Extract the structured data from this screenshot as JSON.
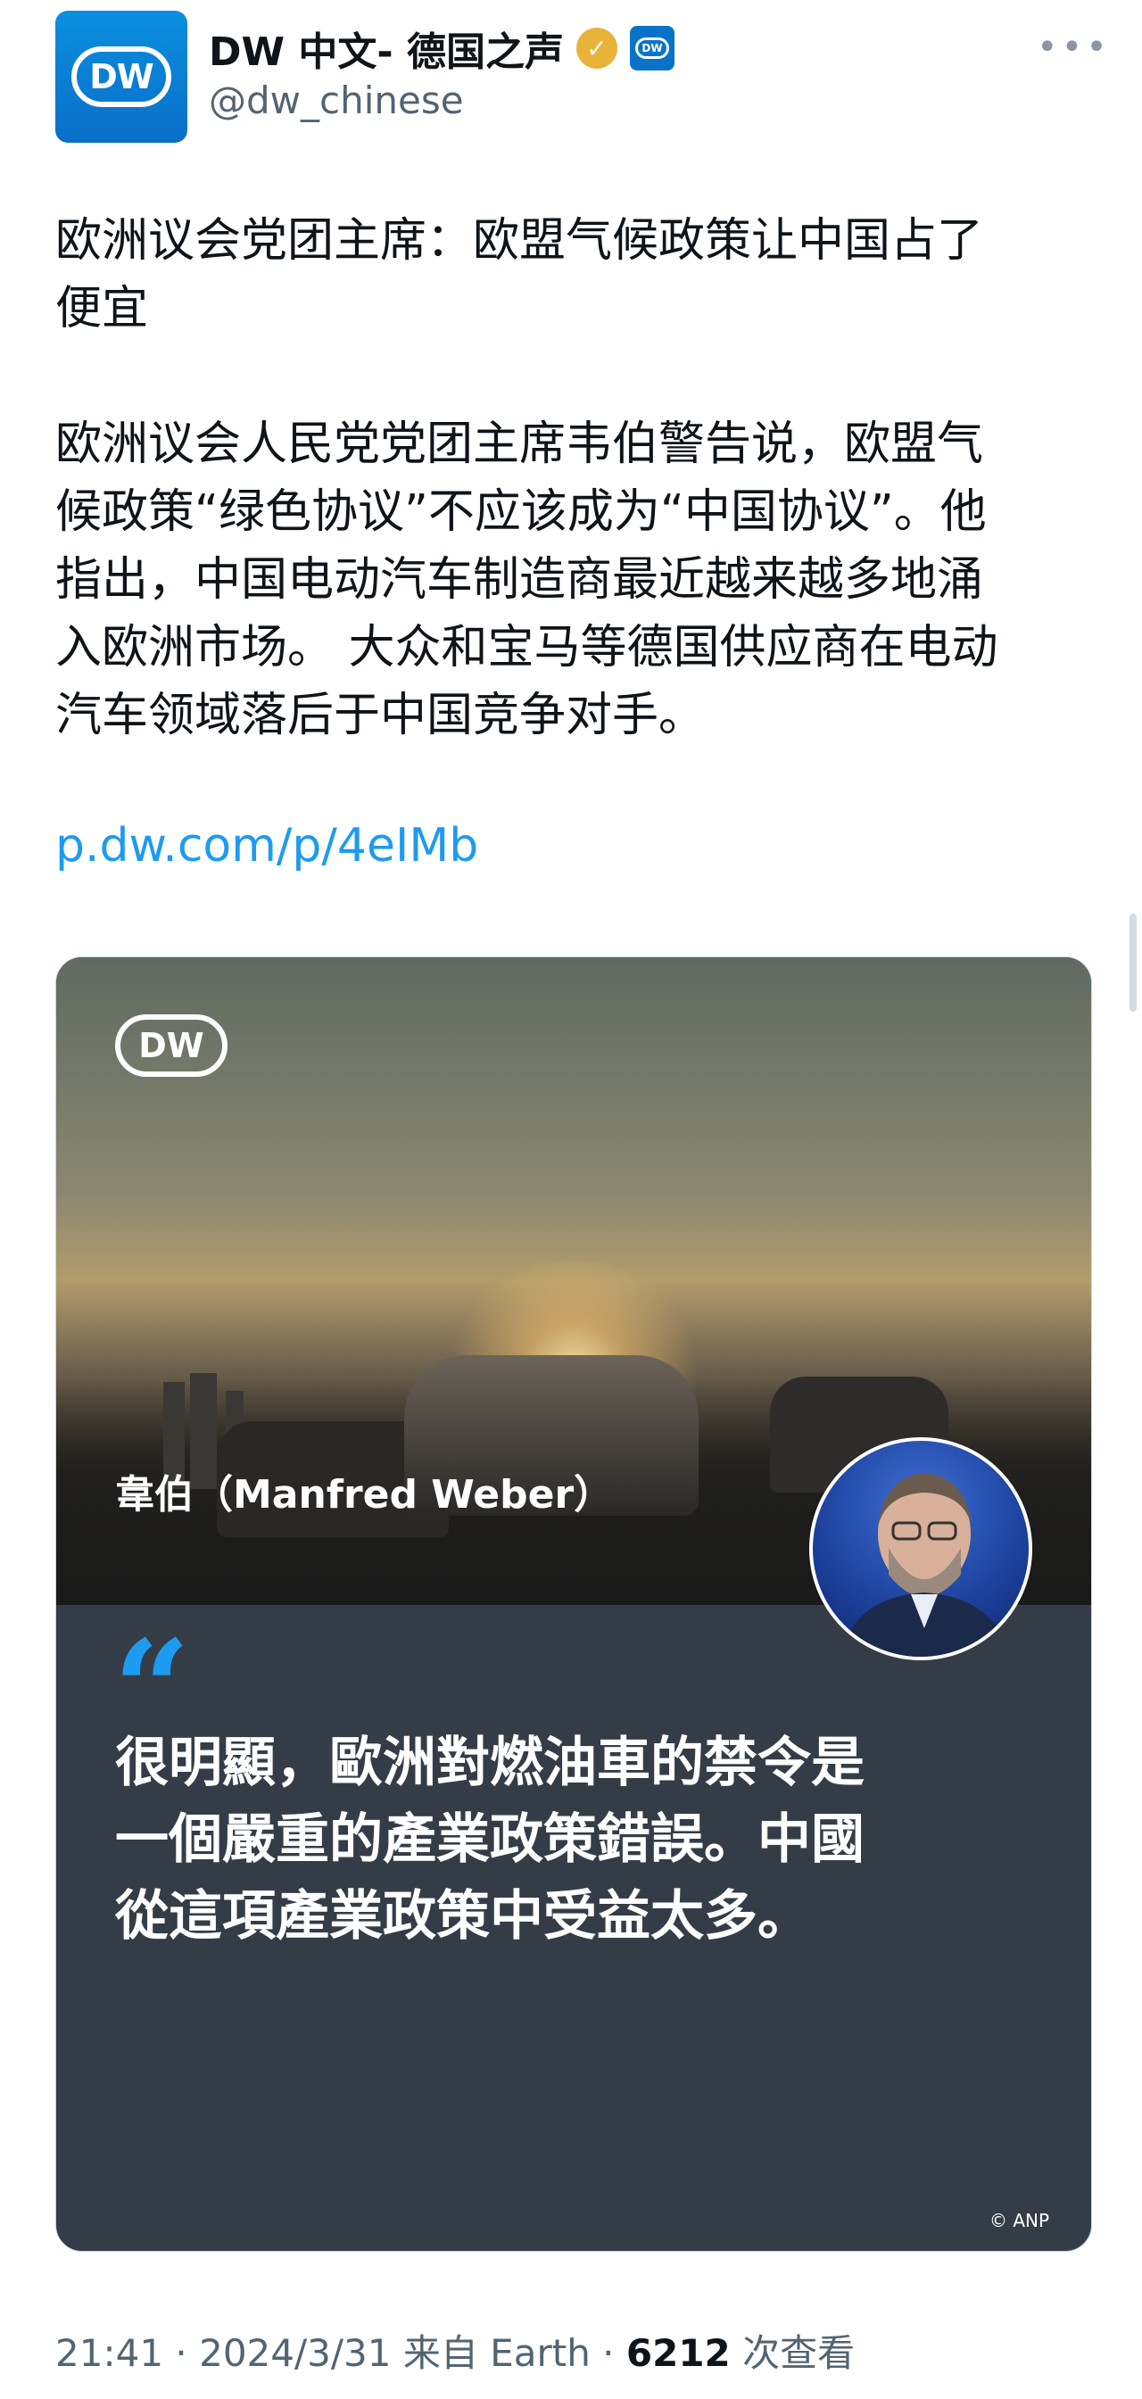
{
  "account": {
    "name": "DW 中文- 德国之声",
    "handle": "@dw_chinese",
    "avatar_logo": "DW",
    "verified_icon": "verified-badge-gold",
    "affiliation_icon": "dw-affiliate-badge",
    "more_icon": "more-dots-icon"
  },
  "post": {
    "text": "欧洲议会党团主席：欧盟气候政策让中国占了\n便宜\n\n欧洲议会人民党党团主席韦伯警告说，欧盟气\n候政策“绿色协议”不应该成为“中国协议”。他\n指出，中国电动汽车制造商最近越来越多地涌\n入欧洲市场。 大众和宝马等德国供应商在电动\n汽车领域落后于中国竞争对手。",
    "link": "p.dw.com/p/4eIMb"
  },
  "card": {
    "logo": "DW",
    "caption": "韋伯（Manfred Weber）",
    "quote_icon": "quote-mark-icon",
    "quote": "很明顯，歐洲對燃油車的禁令是\n一個嚴重的產業政策錯誤。中國\n從這項產業政策中受益太多。",
    "copyright": "© ANP"
  },
  "footer": {
    "time": "21:41",
    "date": "2024/3/31",
    "source": "来自 Earth",
    "views_count": "6212",
    "views_label": "次查看"
  },
  "colors": {
    "link": "#1d9bf0",
    "dw_blue": "#0a73c9",
    "card_bg": "#343d47",
    "muted": "#536471"
  }
}
